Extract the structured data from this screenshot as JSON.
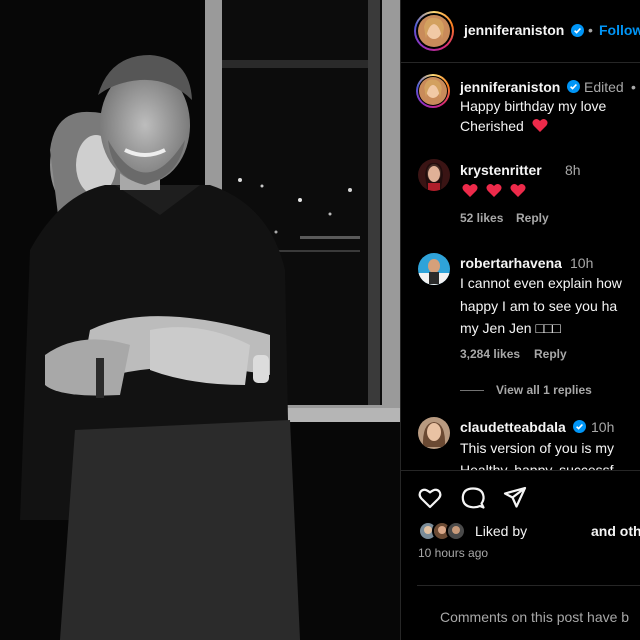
{
  "header": {
    "username": "jenniferaniston",
    "separator": "•",
    "follow_label": "Follow"
  },
  "caption": {
    "username": "jenniferaniston",
    "status": "Edited",
    "separator": "•",
    "lines": [
      "Happy birthday my love",
      "Cherished"
    ]
  },
  "comments": [
    {
      "username": "krystenritter",
      "time": "8h",
      "likes": "52 likes",
      "reply_label": "Reply"
    },
    {
      "username": "robertarhavena",
      "time": "10h",
      "lines": [
        "I cannot even explain how",
        "happy I am to see you ha",
        "my Jen Jen □□□"
      ],
      "likes": "3,284 likes",
      "reply_label": "Reply",
      "view_replies": "View all 1 replies"
    },
    {
      "username": "claudetteabdala",
      "time": "10h",
      "lines": [
        "This version of you is my",
        "Healthy, happy, successf"
      ]
    }
  ],
  "engagement": {
    "liked_by_label": "Liked by",
    "and_others": "and oth",
    "timestamp": "10 hours ago",
    "comments_disabled": "Comments on this post have b"
  },
  "icons": {
    "like": "heart-outline-icon",
    "comment": "comment-bubble-icon",
    "share": "paper-plane-icon",
    "verified": "verified-badge-icon",
    "heart_emoji": "red-heart-emoji"
  },
  "colors": {
    "accent": "#0095f6",
    "heart": "#ed2a4a",
    "text": "#f5f5f5",
    "muted": "#a8a8a8"
  }
}
